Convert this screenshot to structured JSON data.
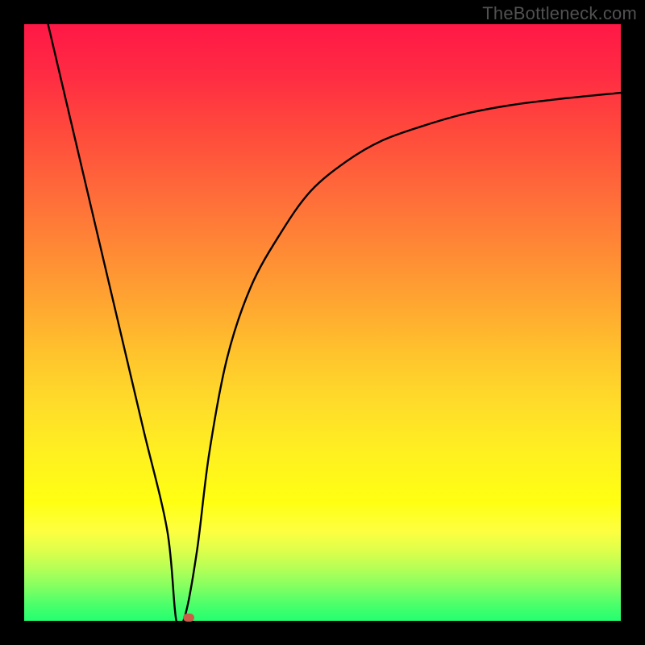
{
  "watermark": "TheBottleneck.com",
  "chart_data": {
    "type": "line",
    "title": "",
    "xlabel": "",
    "ylabel": "",
    "xlim": [
      0,
      100
    ],
    "ylim": [
      0,
      100
    ],
    "series": [
      {
        "name": "curve",
        "x": [
          4,
          8,
          12,
          16,
          20,
          24,
          25.5,
          27,
          29,
          31,
          34,
          38,
          43,
          48,
          54,
          60,
          67,
          74,
          82,
          90,
          100
        ],
        "y": [
          100,
          83,
          66,
          49,
          32,
          15,
          0,
          1,
          12,
          28,
          44,
          56,
          65,
          72,
          77,
          80.5,
          83,
          85,
          86.5,
          87.5,
          88.5
        ]
      }
    ],
    "marker": {
      "x": 27.5,
      "y": 0.6
    },
    "grid": false,
    "legend": false
  },
  "colors": {
    "background_frame": "#000000",
    "curve": "#000000",
    "marker": "#cb5c48",
    "watermark": "#515151"
  }
}
